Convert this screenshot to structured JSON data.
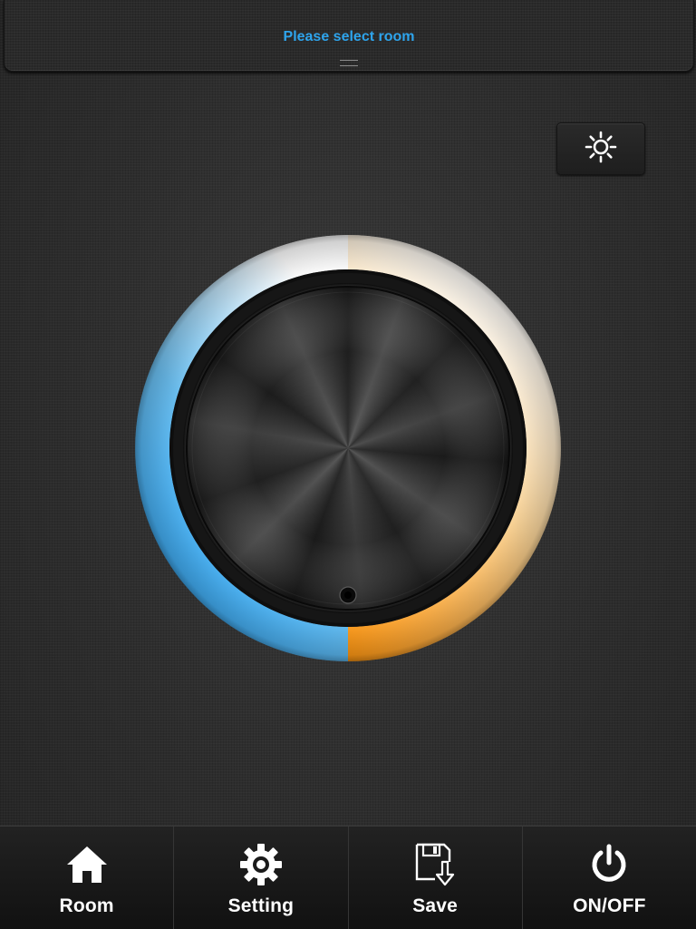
{
  "header": {
    "room_label": "Please select room"
  },
  "controls": {
    "brightness_icon": "sun-icon"
  },
  "dial": {
    "cool_color": "#2ba2f2",
    "neutral_color": "#ffffff",
    "warm_color": "#ff9a12",
    "position": 0.5
  },
  "toolbar": {
    "items": [
      {
        "label": "Room",
        "icon": "home-icon"
      },
      {
        "label": "Setting",
        "icon": "gear-icon"
      },
      {
        "label": "Save",
        "icon": "save-icon"
      },
      {
        "label": "ON/OFF",
        "icon": "power-icon"
      }
    ]
  }
}
